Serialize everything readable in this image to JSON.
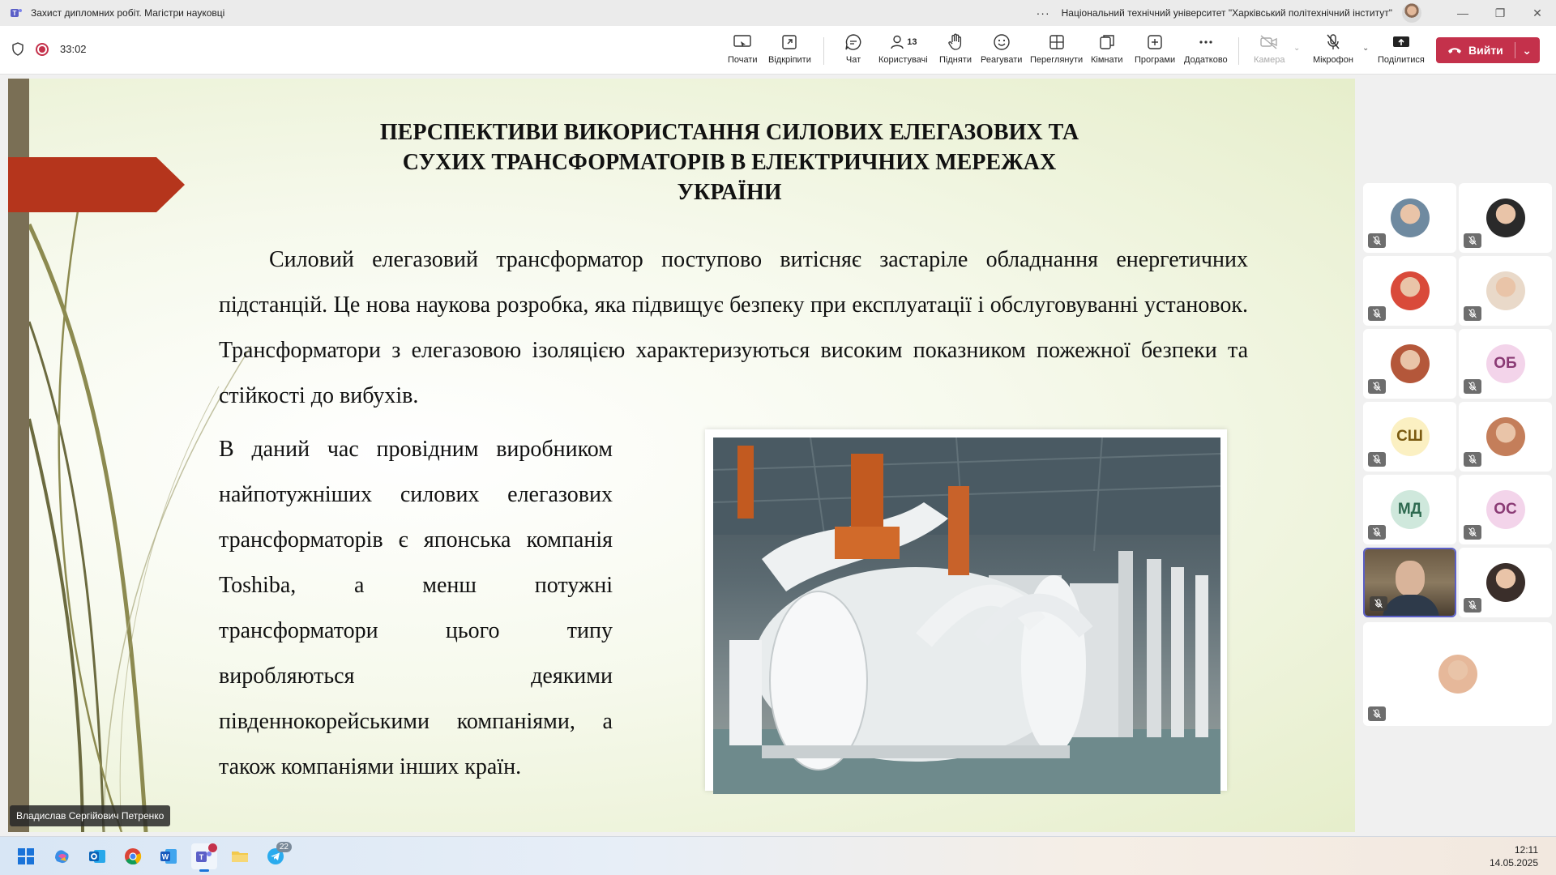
{
  "window": {
    "title": "Захист дипломних робіт. Магістри науковці",
    "more": "···",
    "organization": "Національний технічний університет \"Харківський політехнічний інститут\""
  },
  "meeting": {
    "timer": "33:02",
    "toolbar": {
      "start": "Почати",
      "detach": "Відкріпити",
      "chat": "Чат",
      "people": "Користувачі",
      "people_count": "13",
      "raise": "Підняти",
      "react": "Реагувати",
      "view": "Переглянути",
      "rooms": "Кімнати",
      "apps": "Програми",
      "more": "Додатково",
      "camera": "Камера",
      "mic": "Мікрофон",
      "share": "Поділитися",
      "leave": "Вийти"
    }
  },
  "slide": {
    "title_lines": [
      "ПЕРСПЕКТИВИ ВИКОРИСТАННЯ СИЛОВИХ ЕЛЕГАЗОВИХ ТА",
      "СУХИХ ТРАНСФОРМАТОРІВ В ЕЛЕКТРИЧНИХ МЕРЕЖАХ",
      "УКРАЇНИ"
    ],
    "paragraph1": "Силовий елегазовий трансформатор поступово витісняє застаріле обладнання енергетичних підстанцій. Це нова наукова розробка, яка підвищує безпеку при експлуатації і обслуговуванні установок. Трансформатори з елегазовою ізоляцією характеризуються високим показником  пожежної безпеки та стійкості до вибухів.",
    "paragraph2": "В даний час провідним виробником найпотужніших силових елегазових трансформаторів є японська компанія Toshiba, а менш потужні трансформатори цього типу виробляються деякими південнокорейськими компаніями, а також компаніями інших країн.",
    "speaker": "Владислав Сергійович Петренко"
  },
  "participants": [
    {
      "initials": "",
      "kind": "photo",
      "color": "#6f8aa0"
    },
    {
      "initials": "",
      "kind": "photo",
      "color": "#2a2a2a"
    },
    {
      "initials": "",
      "kind": "photo",
      "color": "#d94a3a"
    },
    {
      "initials": "",
      "kind": "photo",
      "color": "#e9d9c9"
    },
    {
      "initials": "",
      "kind": "photo",
      "color": "#b4573a"
    },
    {
      "initials": "ОБ",
      "kind": "initials",
      "color": "#f3d4ea",
      "text_color": "#8a3a74"
    },
    {
      "initials": "СШ",
      "kind": "initials",
      "color": "#fbf0c2",
      "text_color": "#7a5a10"
    },
    {
      "initials": "",
      "kind": "photo",
      "color": "#c47e5a"
    },
    {
      "initials": "МД",
      "kind": "initials",
      "color": "#cfe8dc",
      "text_color": "#2e6a50"
    },
    {
      "initials": "ОС",
      "kind": "initials",
      "color": "#f3d4ea",
      "text_color": "#8a3a74"
    },
    {
      "initials": "",
      "kind": "video",
      "color": "#7a6a52"
    },
    {
      "initials": "",
      "kind": "photo",
      "color": "#3a2e2a"
    },
    {
      "initials": "",
      "kind": "photo",
      "color": "#e6b89a"
    }
  ],
  "taskbar": {
    "telegram_badge": "22",
    "time": "12:11",
    "date": "14.05.2025"
  }
}
